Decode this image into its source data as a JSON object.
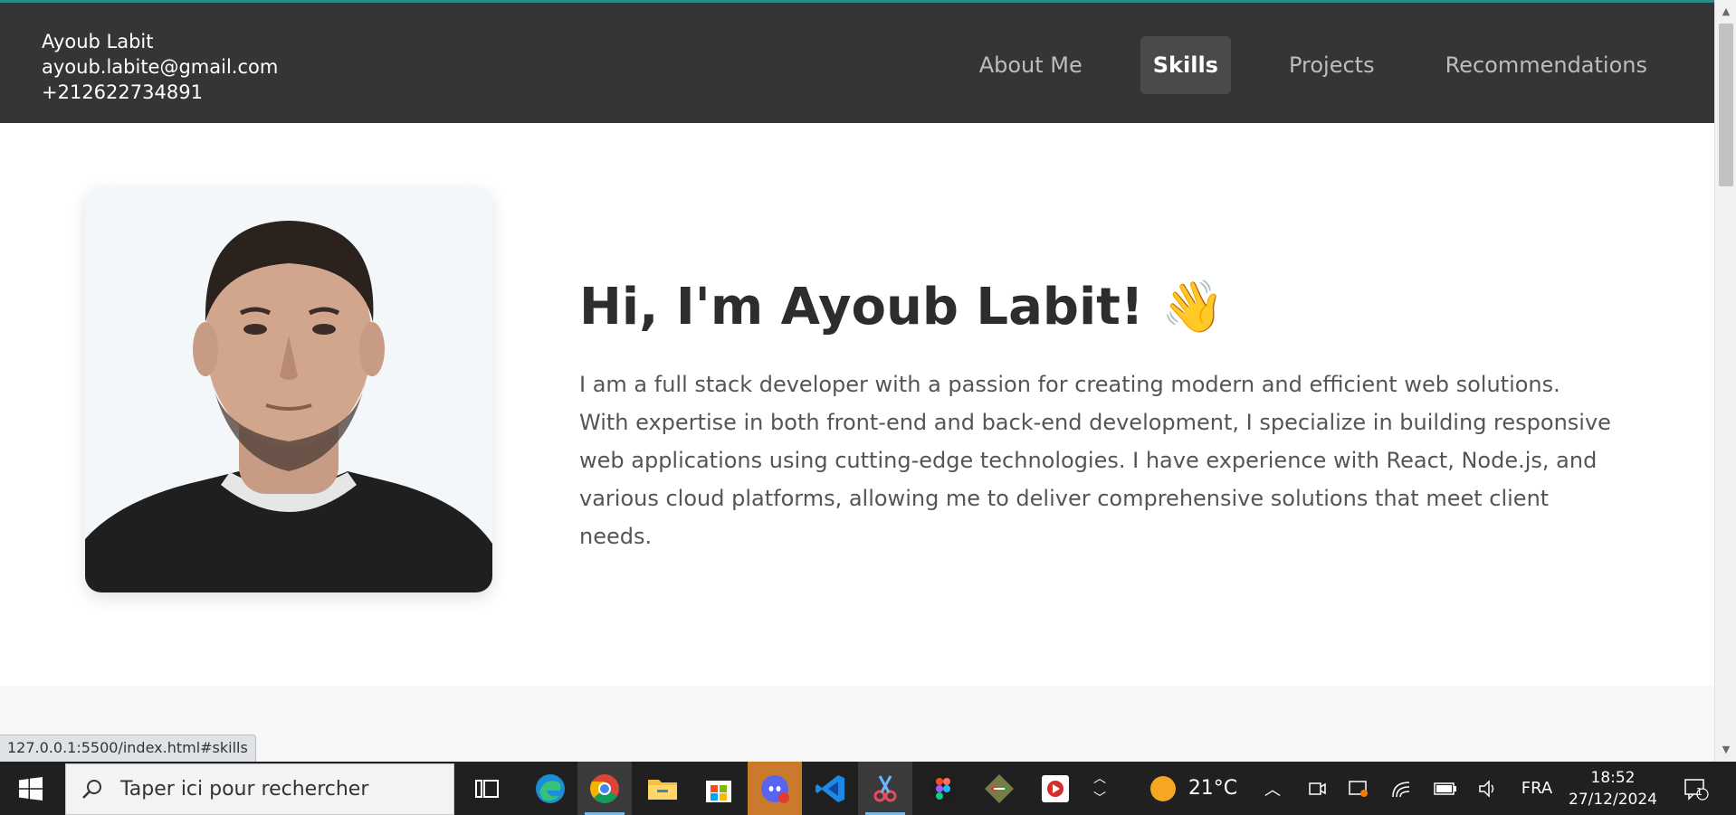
{
  "header": {
    "name": "Ayoub Labit",
    "email": "ayoub.labite@gmail.com",
    "phone": "+212622734891"
  },
  "nav": {
    "items": [
      "About Me",
      "Skills",
      "Projects",
      "Recommendations"
    ],
    "active": "Skills"
  },
  "hero": {
    "title": "Hi, I'm Ayoub Labit! 👋",
    "description": "I am a full stack developer with a passion for creating modern and efficient web solutions. With expertise in both front-end and back-end development, I specialize in building responsive web applications using cutting-edge technologies. I have experience with React, Node.js, and various cloud platforms, allowing me to deliver comprehensive solutions that meet client needs."
  },
  "statusbar": {
    "url": "127.0.0.1:5500/index.html#skills"
  },
  "taskbar": {
    "search_placeholder": "Taper ici pour rechercher",
    "weather": "21°C",
    "language": "FRA",
    "time": "18:52",
    "date": "27/12/2024",
    "notifications": "1",
    "apps": [
      "task-view-icon",
      "edge-icon",
      "chrome-icon",
      "file-explorer-icon",
      "store-icon",
      "discord-icon",
      "vscode-icon",
      "snipping-tool-icon",
      "figma-icon",
      "git-icon",
      "media-player-icon"
    ]
  },
  "colors": {
    "header_bg": "#353535",
    "active_nav_bg": "#4a4a4a",
    "title_text": "#2d2d2d",
    "body_text": "#555555",
    "taskbar_bg": "#202020"
  }
}
